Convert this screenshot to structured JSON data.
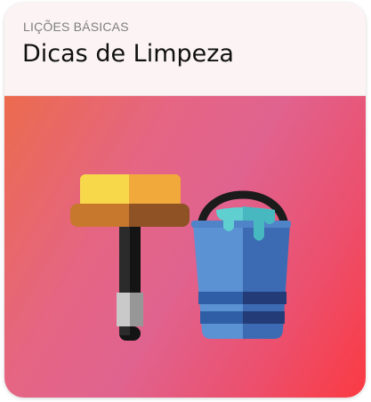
{
  "card": {
    "eyebrow": "LIÇÕES BÁSICAS",
    "title": "Dicas de Limpeza"
  },
  "hero": {
    "illustration_icons": [
      "paint-roller-icon",
      "paint-bucket-icon"
    ],
    "gradient_colors": [
      "#ec6b4e",
      "#e0638f",
      "#fb3a42"
    ]
  },
  "colors": {
    "header_bg": "#fcf4f4",
    "title": "#111111",
    "eyebrow": "#7e7e7e"
  }
}
